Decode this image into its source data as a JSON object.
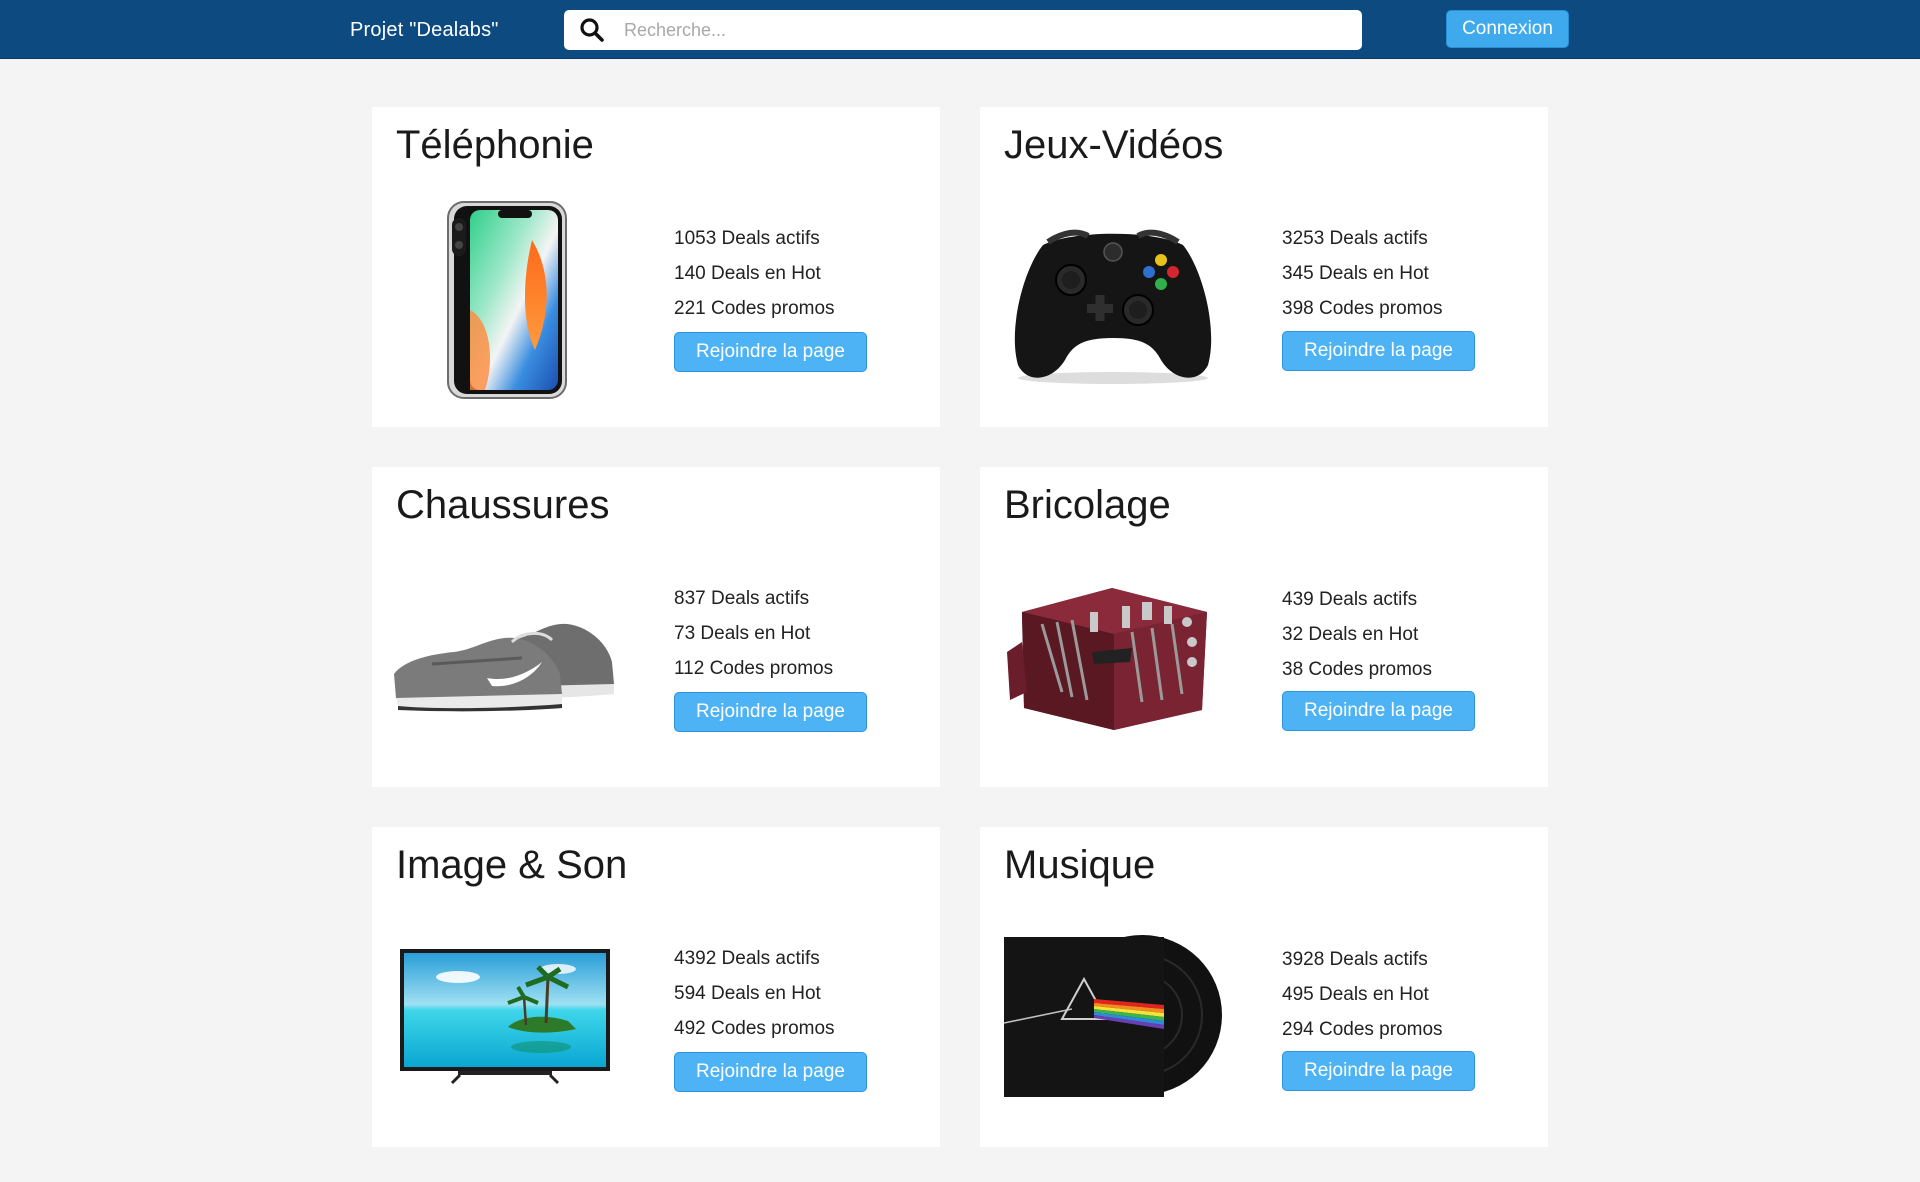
{
  "navbar": {
    "brand": "Projet \"Dealabs\"",
    "search_placeholder": "Recherche...",
    "login_label": "Connexion"
  },
  "categories": [
    {
      "title": "Téléphonie",
      "image": "smartphone-image",
      "active": "1053 Deals actifs",
      "hot": "140 Deals en Hot",
      "codes": "221 Codes promos",
      "button": "Rejoindre la page"
    },
    {
      "title": "Jeux-Vidéos",
      "image": "game-controller-image",
      "active": "3253 Deals actifs",
      "hot": "345 Deals en Hot",
      "codes": "398 Codes promos",
      "button": "Rejoindre la page"
    },
    {
      "title": "Chaussures",
      "image": "sneaker-image",
      "active": "837 Deals actifs",
      "hot": "73 Deals en Hot",
      "codes": "112 Codes promos",
      "button": "Rejoindre la page"
    },
    {
      "title": "Bricolage",
      "image": "toolbox-image",
      "active": "439 Deals actifs",
      "hot": "32 Deals en Hot",
      "codes": "38 Codes promos",
      "button": "Rejoindre la page"
    },
    {
      "title": "Image & Son",
      "image": "television-image",
      "active": "4392 Deals actifs",
      "hot": "594 Deals en Hot",
      "codes": "492 Codes promos",
      "button": "Rejoindre la page"
    },
    {
      "title": "Musique",
      "image": "vinyl-album-image",
      "active": "3928 Deals actifs",
      "hot": "495 Deals en Hot",
      "codes": "294 Codes promos",
      "button": "Rejoindre la page"
    }
  ],
  "colors": {
    "navbar": "#0d4a7f",
    "button": "#4db3f5",
    "background": "#f4f4f4"
  }
}
